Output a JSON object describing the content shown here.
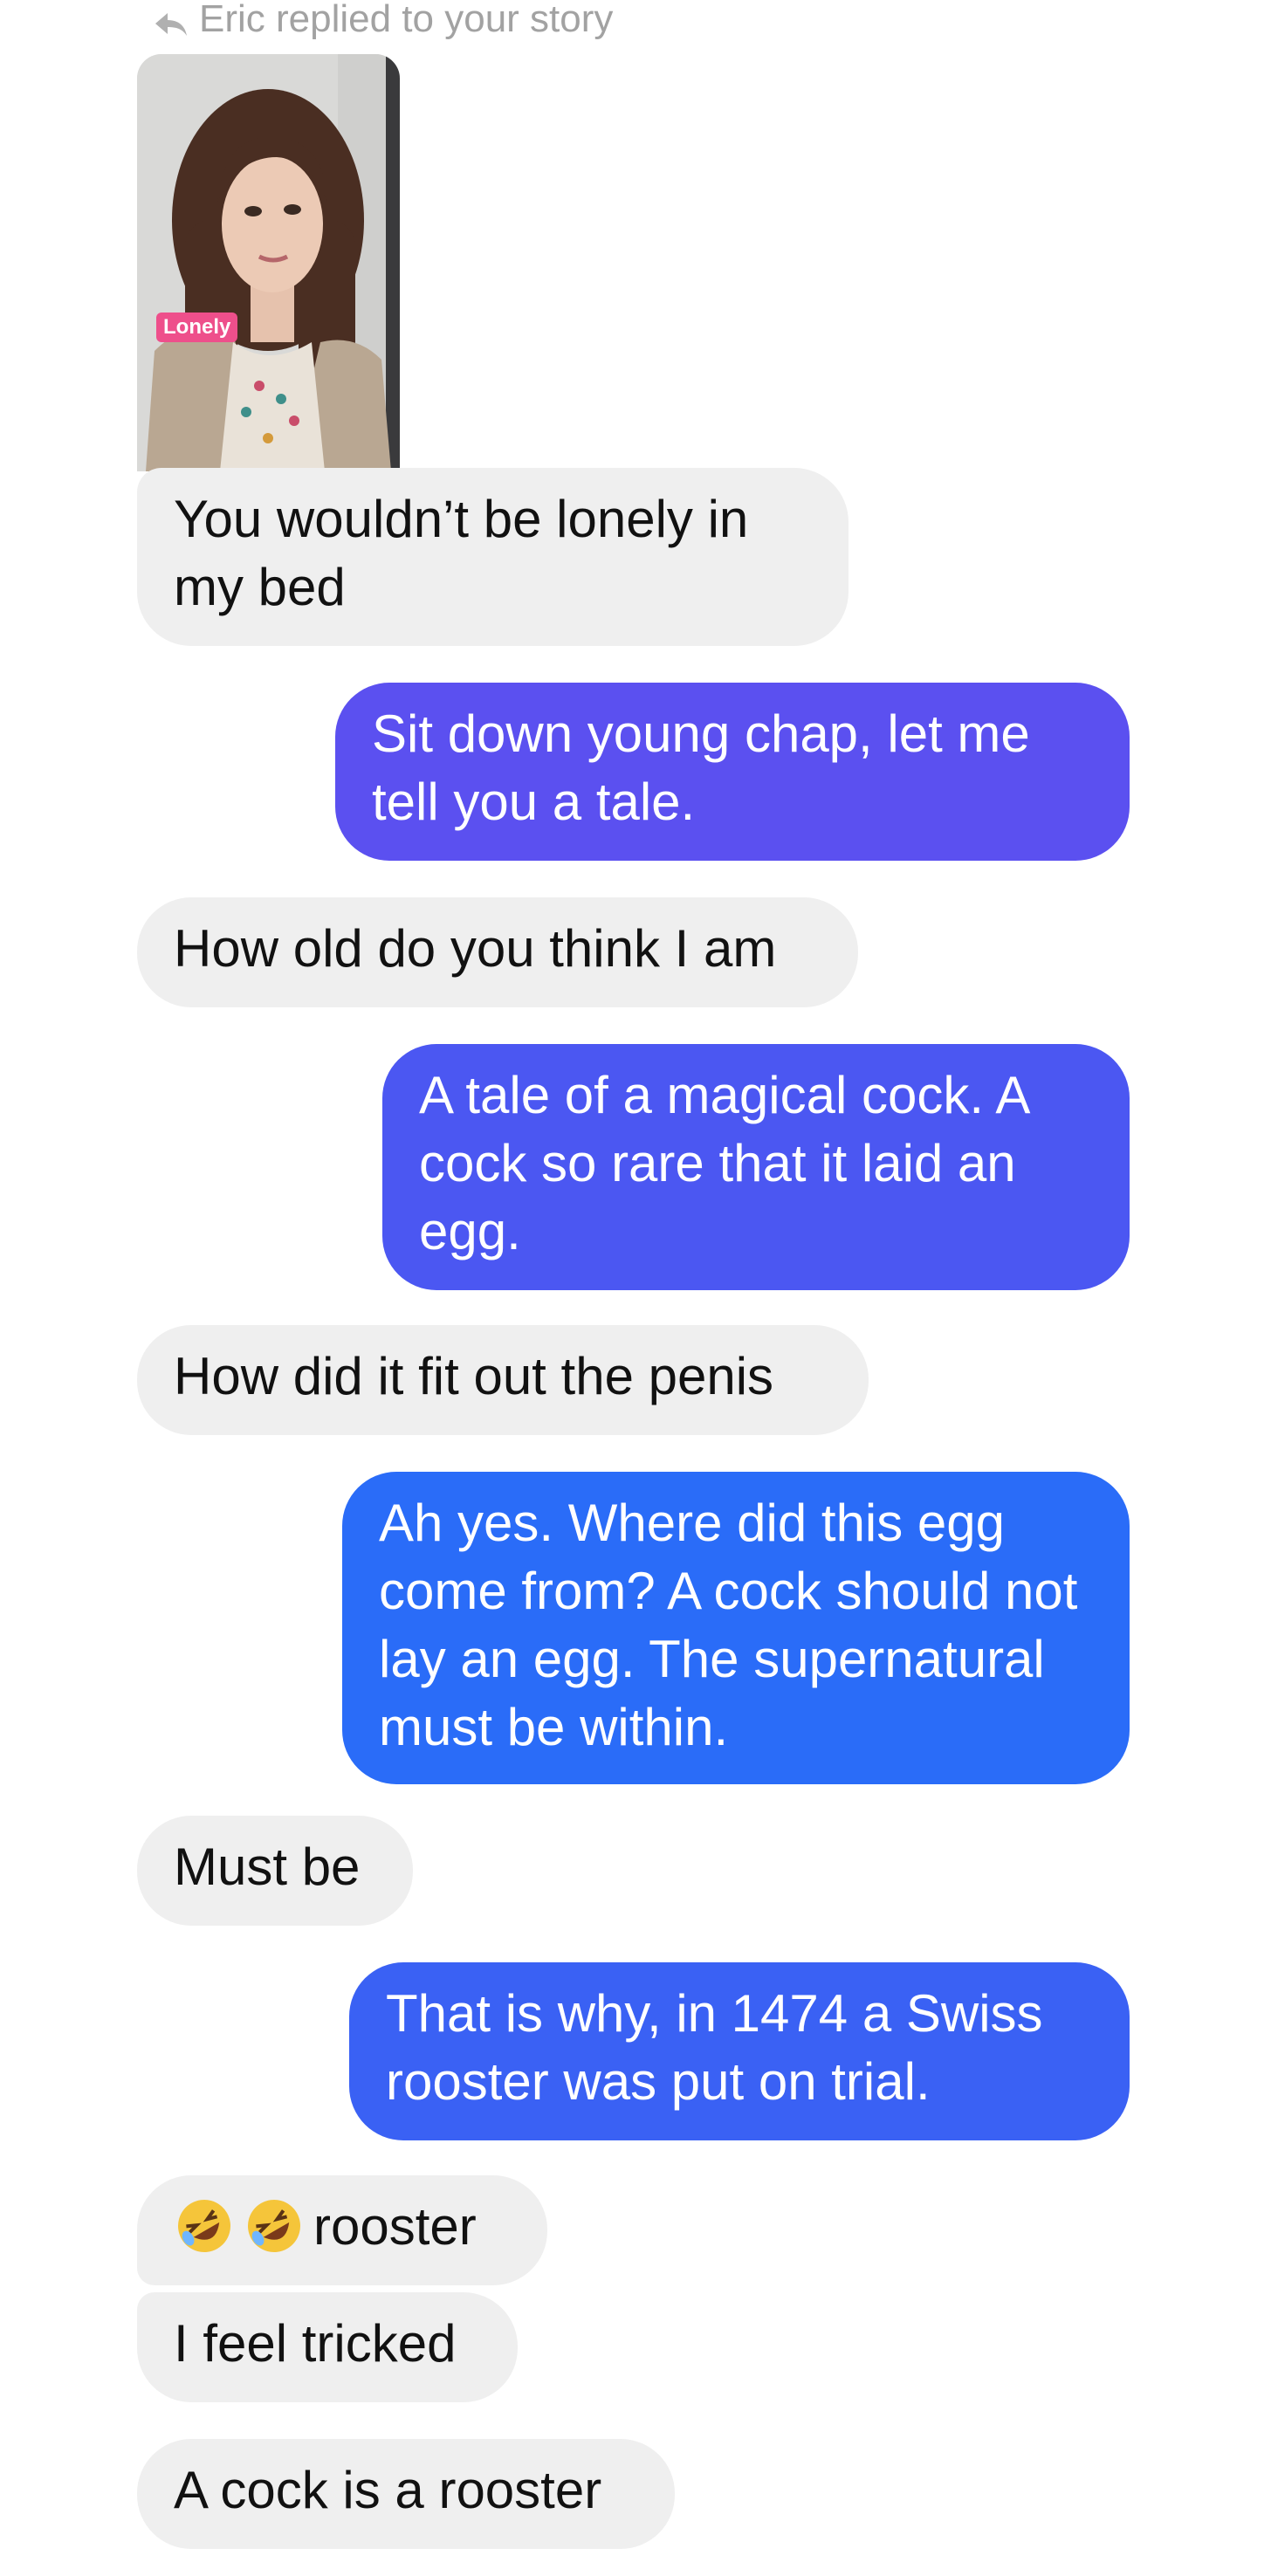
{
  "story_reply": {
    "label": "Eric replied to your story",
    "story_tag": "Lonely"
  },
  "messages": [
    {
      "sender": "them",
      "text": "You wouldn’t be lonely in my bed"
    },
    {
      "sender": "me",
      "text": "Sit down young chap, let me tell you a tale."
    },
    {
      "sender": "them",
      "text": "How old do you think I am"
    },
    {
      "sender": "me",
      "text": "A tale of a magical cock. A cock so rare that it laid an egg."
    },
    {
      "sender": "them",
      "text": "How did it fit out the penis"
    },
    {
      "sender": "me",
      "text": "Ah yes. Where did this egg come from? A cock should not lay an egg. The supernatural must be within."
    },
    {
      "sender": "them",
      "text": "Must be"
    },
    {
      "sender": "me",
      "text": "That is why, in 1474 a Swiss rooster was put on trial."
    },
    {
      "sender": "them",
      "text": "rooster",
      "emoji": "rolling-on-floor-laughing x2"
    },
    {
      "sender": "them",
      "text": "I feel tricked"
    },
    {
      "sender": "them",
      "text": "A cock is a rooster"
    }
  ],
  "colors": {
    "incoming_bubble": "#efefef",
    "outgoing_purple": "#5b50f0",
    "outgoing_blue": "#2a6cf8",
    "meta_text": "#a2a2a2"
  }
}
